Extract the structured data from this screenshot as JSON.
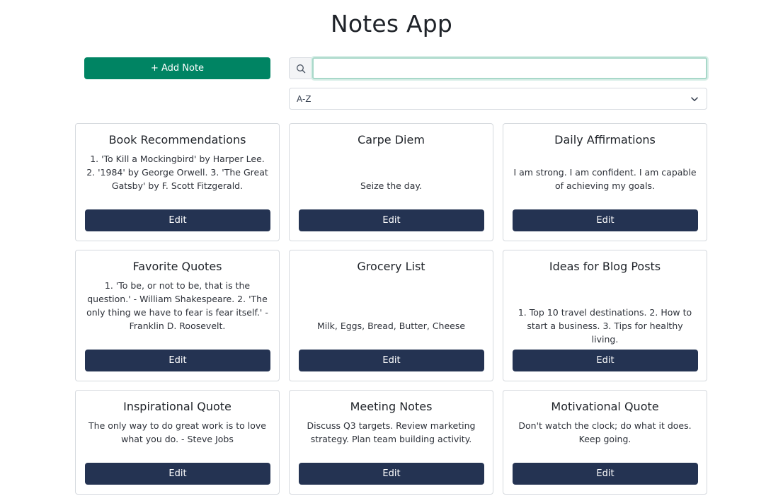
{
  "app": {
    "title": "Notes App"
  },
  "toolbar": {
    "add_label": "+ Add Note",
    "search_value": "",
    "search_placeholder": "",
    "search_icon": "search-icon",
    "sort_value": "A-Z"
  },
  "colors": {
    "add_button": "#008463",
    "edit_button": "#243352"
  },
  "notes": [
    {
      "title": "Book Recommendations",
      "body": "1. 'To Kill a Mockingbird' by Harper Lee. 2. '1984' by George Orwell. 3. 'The Great Gatsby' by F. Scott Fitzgerald.",
      "edit_label": "Edit"
    },
    {
      "title": "Carpe Diem",
      "body": "Seize the day.",
      "edit_label": "Edit"
    },
    {
      "title": "Daily Affirmations",
      "body": "I am strong. I am confident. I am capable of achieving my goals.",
      "edit_label": "Edit"
    },
    {
      "title": "Favorite Quotes",
      "body": "1. 'To be, or not to be, that is the question.' - William Shakespeare. 2. 'The only thing we have to fear is fear itself.' - Franklin D. Roosevelt.",
      "edit_label": "Edit"
    },
    {
      "title": "Grocery List",
      "body": "Milk, Eggs, Bread, Butter, Cheese",
      "edit_label": "Edit"
    },
    {
      "title": "Ideas for Blog Posts",
      "body": "1. Top 10 travel destinations. 2. How to start a business. 3. Tips for healthy living.",
      "edit_label": "Edit"
    },
    {
      "title": "Inspirational Quote",
      "body": "The only way to do great work is to love what you do. - Steve Jobs",
      "edit_label": "Edit"
    },
    {
      "title": "Meeting Notes",
      "body": "Discuss Q3 targets. Review marketing strategy. Plan team building activity.",
      "edit_label": "Edit"
    },
    {
      "title": "Motivational Quote",
      "body": "Don't watch the clock; do what it does. Keep going.",
      "edit_label": "Edit"
    }
  ]
}
